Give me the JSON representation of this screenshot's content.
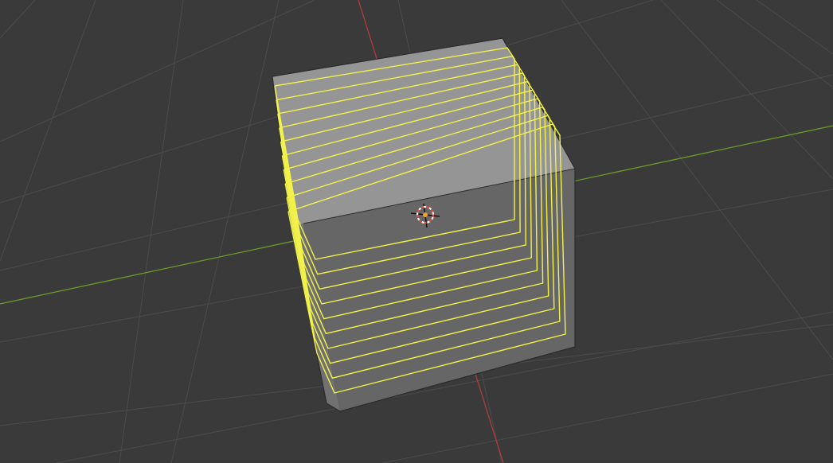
{
  "viewport": {
    "background_color": "#3a3a3a",
    "grid_color": "#4b4b4b",
    "x_axis_color": "#b33a40",
    "y_axis_color": "#6e9a2a"
  },
  "mesh": {
    "object": "cube",
    "top_face_color": "#959595",
    "front_face_color": "#666666",
    "side_face_color": "#6f6f6f",
    "bottom_side_color": "#717171",
    "outline_color": "#2b2b2b",
    "loop_color": "#f2f24a",
    "loop_count": 10
  },
  "cursor_3d": {
    "icon": "3d-cursor-icon",
    "ring_color_a": "#e84b3c",
    "ring_color_b": "#ffffff",
    "origin_color": "#f3a12d"
  }
}
